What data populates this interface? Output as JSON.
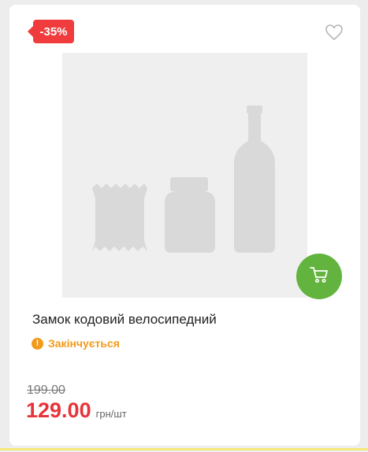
{
  "product": {
    "discount_badge": "-35%",
    "title": "Замок кодовий велосипедний",
    "stock_status": "Закінчується",
    "stock_icon_glyph": "!",
    "old_price": "199.00",
    "price": "129.00",
    "unit": "грн/шт"
  },
  "icons": {
    "favorite": "heart-outline-icon",
    "cart": "shopping-cart-icon",
    "placeholder": "product-placeholder-image"
  },
  "colors": {
    "discount": "#f03c3c",
    "cart_button": "#62b43f",
    "stock_warning": "#f29a1b",
    "price": "#e8333a"
  }
}
